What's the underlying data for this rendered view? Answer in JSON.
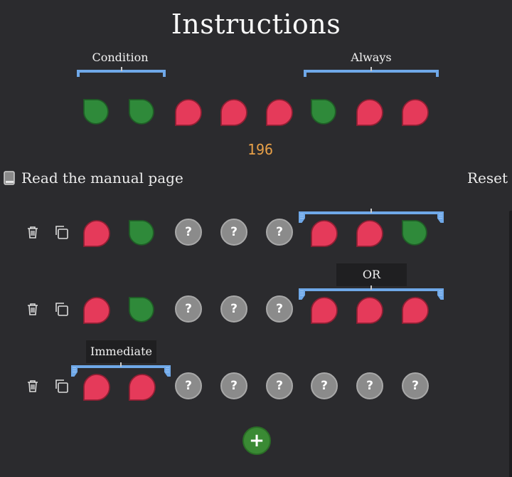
{
  "title": "Instructions",
  "legend": {
    "condition_label": "Condition",
    "always_label": "Always"
  },
  "example_sequence": [
    "green",
    "green",
    "red",
    "red",
    "red",
    "green",
    "red",
    "red"
  ],
  "score": "196",
  "manual_link": "Read the manual page",
  "reset_label": "Reset",
  "rows": [
    {
      "slots": [
        "red",
        "green",
        "unknown",
        "unknown",
        "unknown",
        "red",
        "red",
        "green"
      ],
      "tooltip": ""
    },
    {
      "slots": [
        "red",
        "green",
        "unknown",
        "unknown",
        "unknown",
        "red",
        "red",
        "red"
      ],
      "tooltip": "OR"
    },
    {
      "slots": [
        "red",
        "red",
        "unknown",
        "unknown",
        "unknown",
        "unknown",
        "unknown",
        "unknown"
      ],
      "tooltip": "Immediate"
    }
  ],
  "unknown_glyph": "?",
  "add_button_label": "+",
  "icons": {
    "delete": "trash-icon",
    "duplicate": "copy-icon",
    "manual": "book-icon"
  },
  "colors": {
    "background": "#2b2b2e",
    "green": "#2f8a3a",
    "red": "#e53a5a",
    "bracket": "#6fa8e8",
    "score": "#e8a048",
    "unknown": "#8b8b8b"
  }
}
